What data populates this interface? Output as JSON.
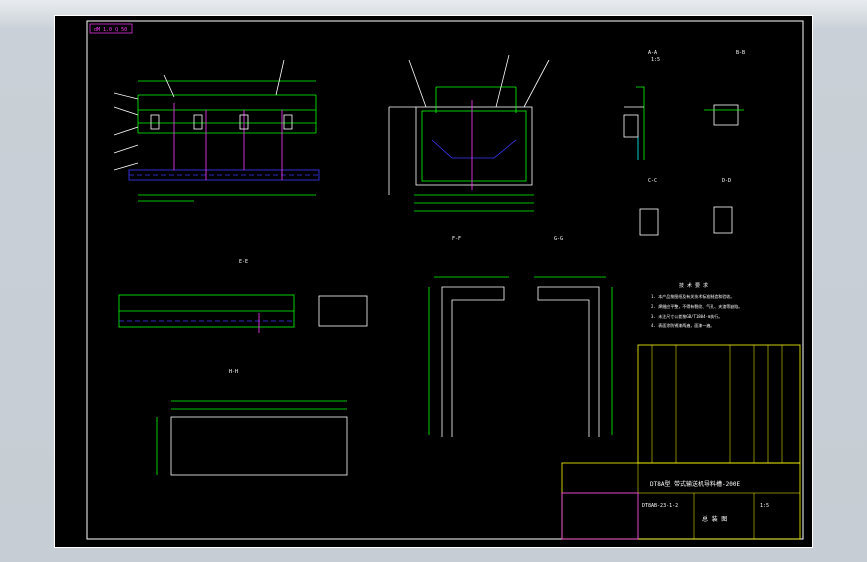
{
  "drawing": {
    "corner_stamp": "dM 1.0 Q 50",
    "section_labels": [
      "A-A",
      "B-B",
      "C-C",
      "D-D",
      "E-E",
      "F-F",
      "G-G",
      "H-H"
    ],
    "scale_label": "1:5",
    "notes_title": "技 术 要 求",
    "notes": [
      "1. 本产品按图纸及有关技术标准制造和验收。",
      "2. 焊缝应平整，不得有裂纹、气孔、夹渣等缺陷。",
      "3. 未注尺寸公差按GB/T1804-m执行。",
      "4. 表面涂防锈漆两遍，面漆一遍。"
    ],
    "title_block": {
      "drawing_title": "DT8A型  带式输送机导料槽-200E",
      "drawing_no": "DT8AB-23-1-2",
      "sheet_name": "总 装 图",
      "scale": "1:5"
    },
    "colors": {
      "sheet": "#000000",
      "frame": "#ffffff",
      "geometry": "#00ff00",
      "dims": "#ff3bff",
      "blue": "#3b3bff",
      "yellow": "#ffff00",
      "text": "#ffffff"
    }
  }
}
